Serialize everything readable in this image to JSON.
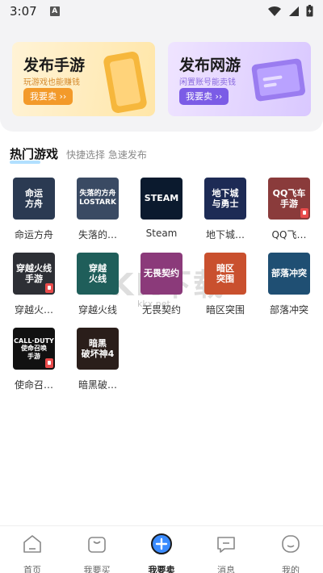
{
  "status_bar": {
    "time": "3:07",
    "notif_letter": "A"
  },
  "banners": {
    "left": {
      "title": "发布手游",
      "subtitle": "玩游戏也能赚钱",
      "button": "我要卖 ››"
    },
    "right": {
      "title": "发布网游",
      "subtitle": "闲置账号能卖钱",
      "button": "我要卖 ››"
    }
  },
  "section": {
    "title": "热门游戏",
    "subtitle": "快捷选择 急速发布"
  },
  "games": [
    {
      "name": "命运方舟",
      "icon_text": "命运\n方舟",
      "bg": "#2b3a52",
      "tag": false
    },
    {
      "name": "失落的…",
      "icon_text": "失落的方舟\nLOSTARK",
      "bg": "#3a4a63",
      "tag": false
    },
    {
      "name": "Steam",
      "icon_text": "STEAM",
      "bg": "#0b1a2e",
      "tag": false
    },
    {
      "name": "地下城…",
      "icon_text": "地下城\n与勇士",
      "bg": "#1d2b55",
      "tag": false
    },
    {
      "name": "QQ飞…",
      "icon_text": "QQ飞车\n手游",
      "bg": "#8a3b3b",
      "tag": true
    },
    {
      "name": "穿越火…",
      "icon_text": "穿越火线\n手游",
      "bg": "#2d2f35",
      "tag": true
    },
    {
      "name": "穿越火线",
      "icon_text": "穿越\n火线",
      "bg": "#1f5e5a",
      "tag": false
    },
    {
      "name": "无畏契约",
      "icon_text": "无畏契约",
      "bg": "#8b3a7a",
      "tag": false
    },
    {
      "name": "暗区突围",
      "icon_text": "暗区\n突围",
      "bg": "#c9502e",
      "tag": false
    },
    {
      "name": "部落冲突",
      "icon_text": "部落冲突",
      "bg": "#1f4f73",
      "tag": false
    },
    {
      "name": "使命召…",
      "icon_text": "CALL·DUTY\n使命召唤\n手游",
      "bg": "#111111",
      "tag": true
    },
    {
      "name": "暗黑破…",
      "icon_text": "暗黑\n破坏神4",
      "bg": "#2a1e1a",
      "tag": false
    }
  ],
  "watermark": {
    "main": "KK下载",
    "sub": "kkx.net"
  },
  "nav": [
    {
      "label": "首页",
      "icon": "home-icon"
    },
    {
      "label": "我要买",
      "icon": "bag-icon"
    },
    {
      "label": "我要卖",
      "icon": "plus-icon"
    },
    {
      "label": "消息",
      "icon": "message-icon"
    },
    {
      "label": "我的",
      "icon": "profile-icon"
    }
  ],
  "colors": {
    "accent": "#3b8cff",
    "sell_orange": "#f39a2a",
    "sell_purple": "#7b5ce6"
  }
}
